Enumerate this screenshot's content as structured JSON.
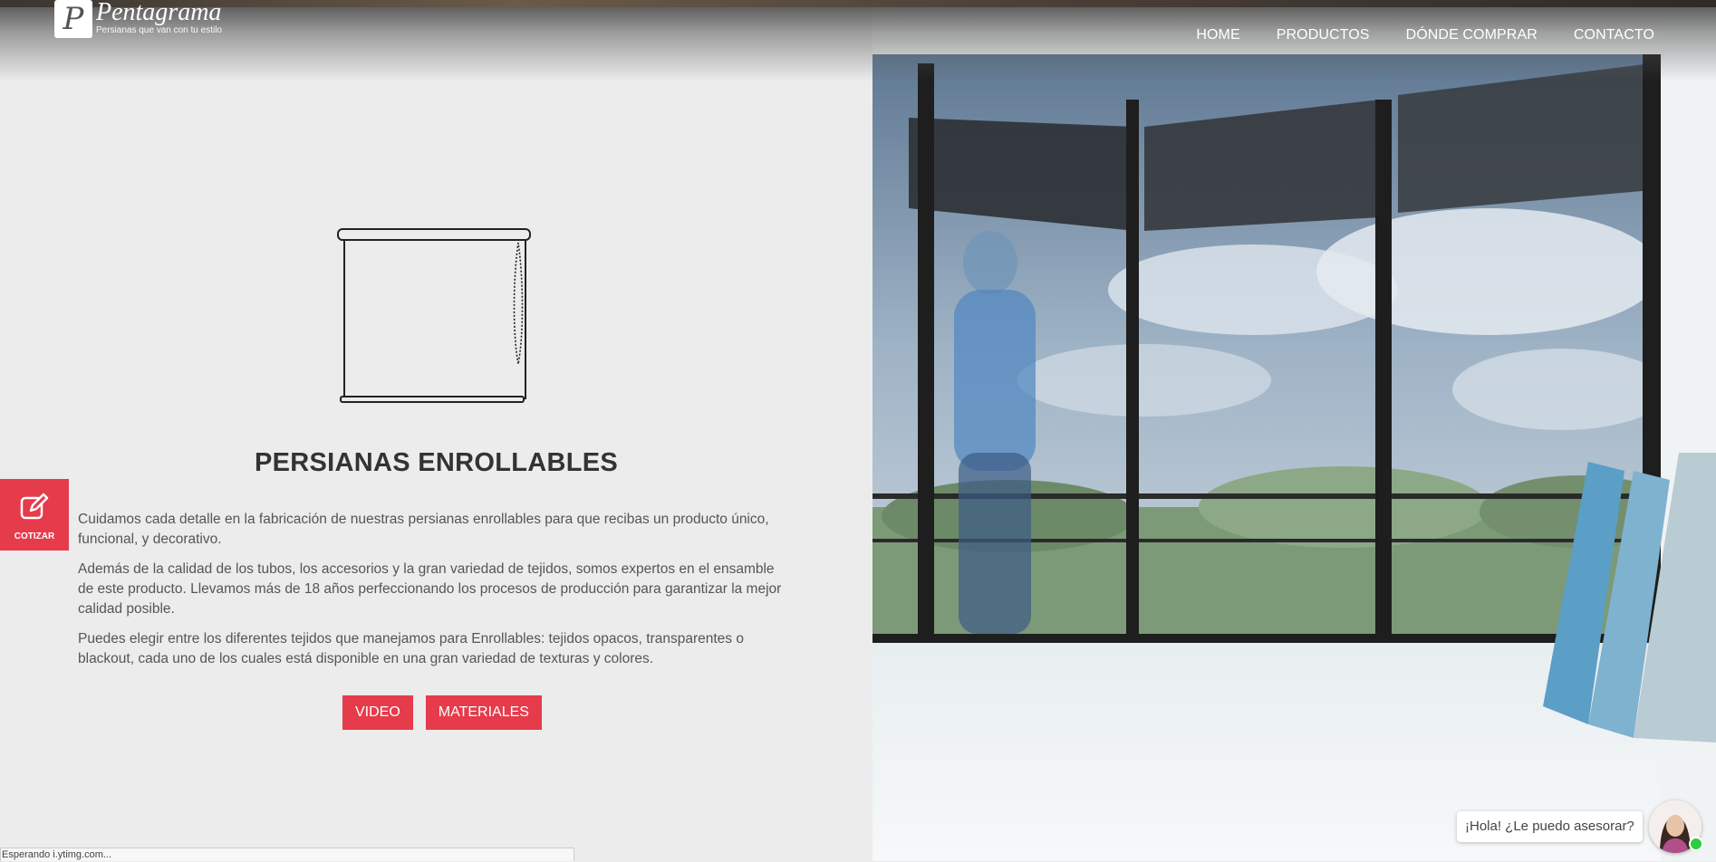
{
  "logo": {
    "mark": "P",
    "name": "Pentagrama",
    "tagline": "Persianas que van con tu estilo"
  },
  "nav": {
    "items": [
      "HOME",
      "PRODUCTOS",
      "DÓNDE COMPRAR",
      "CONTACTO"
    ]
  },
  "product": {
    "title": "PERSIANAS ENROLLABLES",
    "paragraphs": [
      "Cuidamos cada detalle en la fabricación de nuestras persianas enrollables para que recibas un producto único, funcional, y decorativo.",
      "Además de la calidad de los tubos, los accesorios y la gran variedad de tejidos, somos expertos en el ensamble de este producto. Llevamos más de 18 años perfeccionando los procesos de producción para garantizar la mejor calidad posible.",
      "Puedes elegir entre los diferentes tejidos que manejamos para Enrollables: tejidos opacos, transparentes o blackout, cada uno de los cuales está disponible en una gran variedad de texturas y colores."
    ],
    "buttons": {
      "video": "VIDEO",
      "materiales": "MATERIALES"
    }
  },
  "cotizar": {
    "label": "COTIZAR",
    "icon": "edit-icon"
  },
  "chat": {
    "message": "¡Hola! ¿Le puedo asesorar?",
    "status": "online"
  },
  "status_bar": {
    "text": "Esperando i.ytimg.com..."
  },
  "colors": {
    "accent": "#e63b4b",
    "background": "#ececec",
    "text": "#333333"
  }
}
